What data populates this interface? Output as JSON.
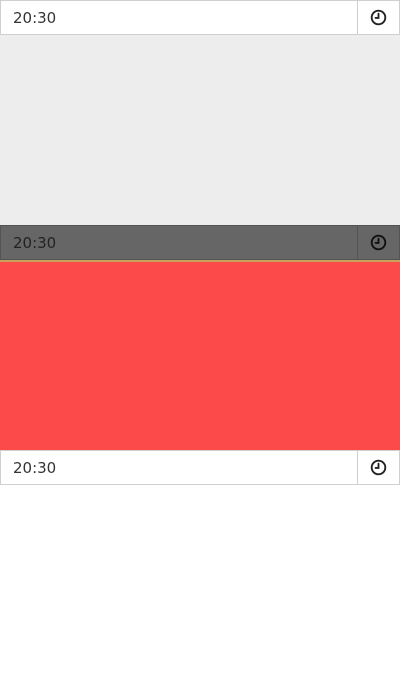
{
  "pickers": {
    "top": {
      "value": "20:30",
      "icon": "clock-icon"
    },
    "middle": {
      "value": "20:30",
      "icon": "clock-icon"
    },
    "bottom": {
      "value": "20:30",
      "icon": "clock-icon"
    }
  },
  "colors": {
    "light_panel": "#ededed",
    "dark_picker": "#666666",
    "dark_picker_underline": "#c9a25a",
    "red_panel": "#fc4a4a"
  }
}
